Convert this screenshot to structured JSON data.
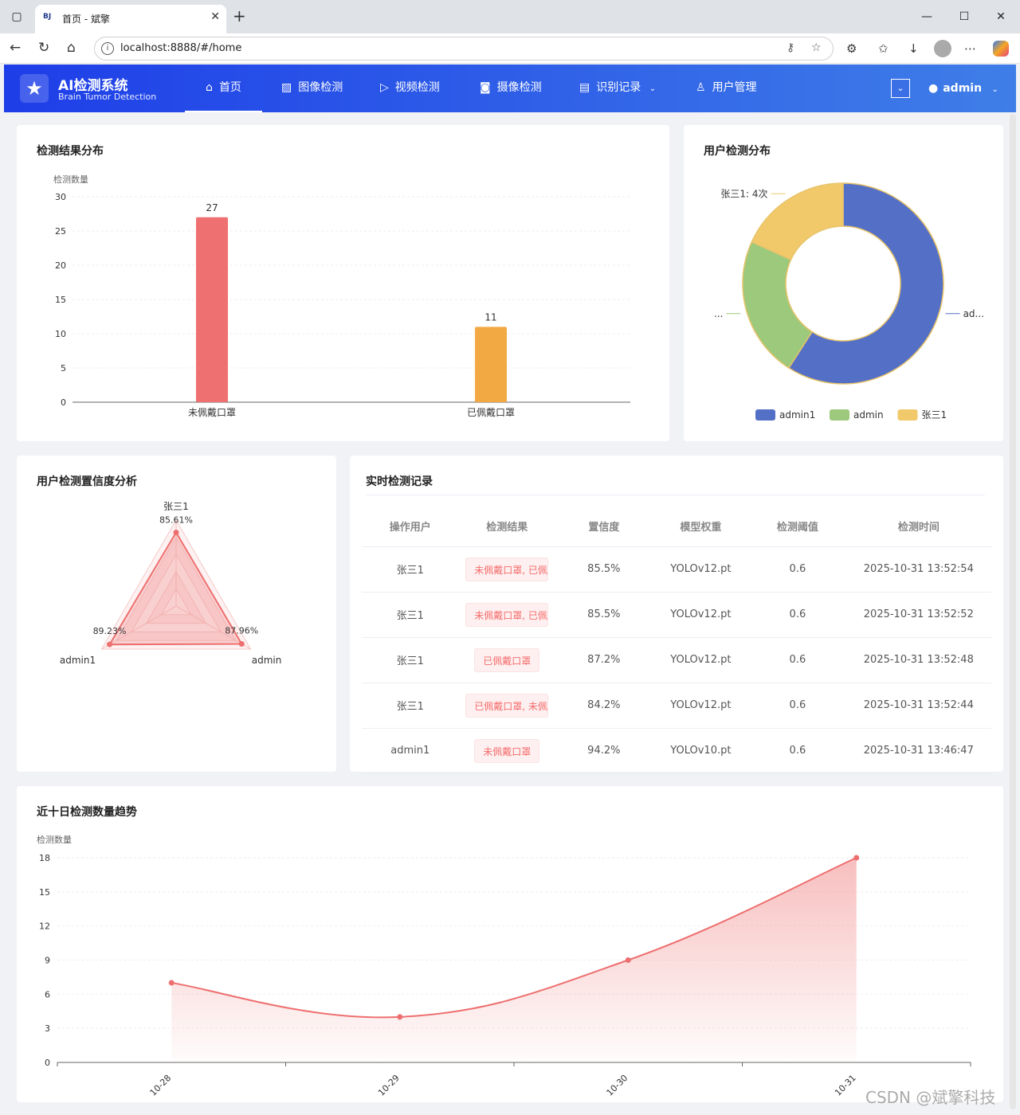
{
  "browser": {
    "tab_favicon": "BJ",
    "tab_title": "首页 - 斌擎",
    "url": "localhost:8888/#/home"
  },
  "app": {
    "title": "AI检测系统",
    "subtitle": "Brain Tumor Detection",
    "nav": [
      {
        "label": "首页",
        "icon": "home-icon"
      },
      {
        "label": "图像检测",
        "icon": "image-icon"
      },
      {
        "label": "视频检测",
        "icon": "play-circle-icon"
      },
      {
        "label": "摄像检测",
        "icon": "camera-icon"
      },
      {
        "label": "识别记录",
        "icon": "document-icon"
      },
      {
        "label": "用户管理",
        "icon": "user-icon"
      }
    ],
    "user": "admin"
  },
  "cards": {
    "bar_title": "检测结果分布",
    "donut_title": "用户检测分布",
    "radar_title": "用户检测置信度分析",
    "table_title": "实时检测记录",
    "trend_title": "近十日检测数量趋势"
  },
  "chart_data": [
    {
      "type": "bar",
      "title": "检测结果分布",
      "ylabel": "检测数量",
      "categories": [
        "未佩戴口罩",
        "已佩戴口罩"
      ],
      "values": [
        27,
        11
      ],
      "colors": [
        "#ee7070",
        "#f2a944"
      ],
      "ylim": [
        0,
        30
      ],
      "yticks": [
        0,
        5,
        10,
        15,
        20,
        25,
        30
      ]
    },
    {
      "type": "pie",
      "title": "用户检测分布",
      "labels": [
        "admin1",
        "admin",
        "张三1"
      ],
      "values": [
        13,
        5,
        4
      ],
      "colors": [
        "#5470c6",
        "#9cc97b",
        "#f1c96b"
      ],
      "callouts": [
        "ad...",
        "...",
        "张三1: 4次"
      ],
      "legend_position": "bottom"
    },
    {
      "type": "radar",
      "title": "用户检测置信度分析",
      "axes": [
        "张三1",
        "admin",
        "admin1"
      ],
      "values": [
        85.61,
        87.96,
        89.23
      ],
      "value_labels": [
        "85.61%",
        "87.96%",
        "89.23%"
      ],
      "max": 100,
      "color": "#ee6f6f"
    },
    {
      "type": "area",
      "title": "近十日检测数量趋势",
      "ylabel": "检测数量",
      "x": [
        "10-28",
        "10-29",
        "10-30",
        "10-31"
      ],
      "values": [
        7,
        4,
        9,
        18
      ],
      "ylim": [
        0,
        18
      ],
      "yticks": [
        0,
        3,
        6,
        9,
        12,
        15,
        18
      ],
      "color": "#ee6f6f"
    }
  ],
  "table": {
    "headers": [
      "操作用户",
      "检测结果",
      "置信度",
      "模型权重",
      "检测阈值",
      "检测时间"
    ],
    "rows": [
      [
        "张三1",
        "未佩戴口罩, 已佩戴口罩",
        "85.5%",
        "YOLOv12.pt",
        "0.6",
        "2025-10-31 13:52:54"
      ],
      [
        "张三1",
        "未佩戴口罩, 已佩戴口罩",
        "85.5%",
        "YOLOv12.pt",
        "0.6",
        "2025-10-31 13:52:52"
      ],
      [
        "张三1",
        "已佩戴口罩",
        "87.2%",
        "YOLOv12.pt",
        "0.6",
        "2025-10-31 13:52:48"
      ],
      [
        "张三1",
        "已佩戴口罩, 未佩戴口罩",
        "84.2%",
        "YOLOv12.pt",
        "0.6",
        "2025-10-31 13:52:44"
      ],
      [
        "admin1",
        "未佩戴口罩",
        "94.2%",
        "YOLOv10.pt",
        "0.6",
        "2025-10-31 13:46:47"
      ]
    ]
  },
  "watermark": "CSDN @斌擎科技"
}
